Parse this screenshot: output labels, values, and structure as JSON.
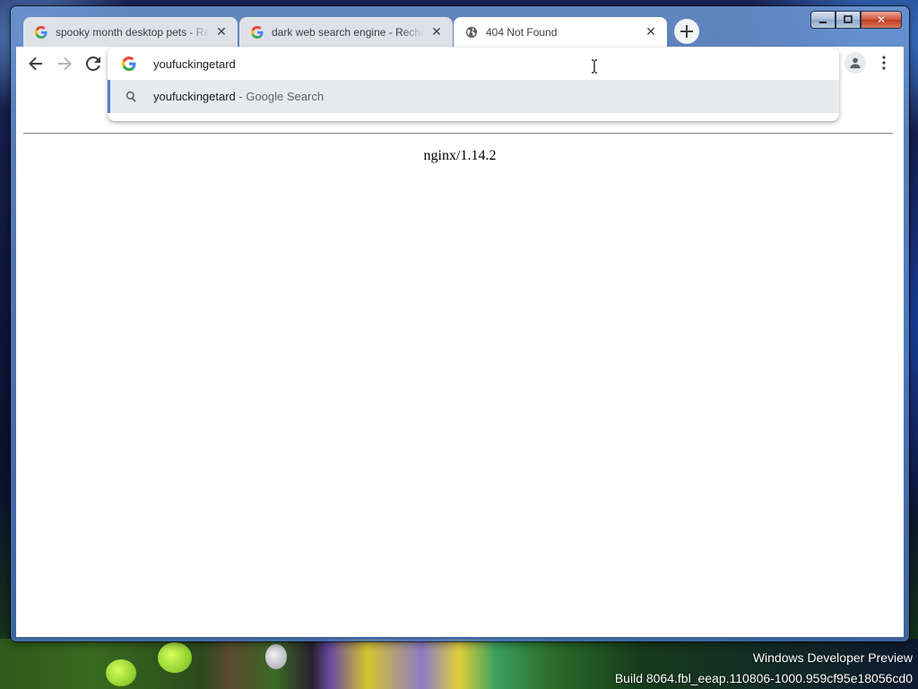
{
  "desktop": {
    "watermark_line1": "Windows Developer Preview",
    "watermark_line2": "Build 8064.fbl_eeap.110806-1000.959cf95e18056cd0"
  },
  "window_controls": {
    "minimize_glyph": "‒",
    "maximize_glyph": "□",
    "close_glyph": "✕"
  },
  "tabs": [
    {
      "title": "spooky month desktop pets - Recherche Google",
      "favicon": "google-g-icon",
      "active": false
    },
    {
      "title": "dark web search engine - Recherche Google",
      "favicon": "google-g-icon",
      "active": false
    },
    {
      "title": "404 Not Found",
      "favicon": "globe-icon",
      "active": true
    }
  ],
  "tab_close_glyph": "✕",
  "new_tab_glyph": "+",
  "omnibox": {
    "value": "youfuckingetard",
    "suggestion": {
      "query": "youfuckingetard",
      "separator": " - ",
      "source": "Google Search"
    }
  },
  "page": {
    "server_signature": "nginx/1.14.2"
  },
  "colors": {
    "tab_inactive": "#dee1e6",
    "tab_active": "#ffffff",
    "suggestion_highlight": "#e8eaed",
    "suggestion_accent": "#4f80d6"
  }
}
